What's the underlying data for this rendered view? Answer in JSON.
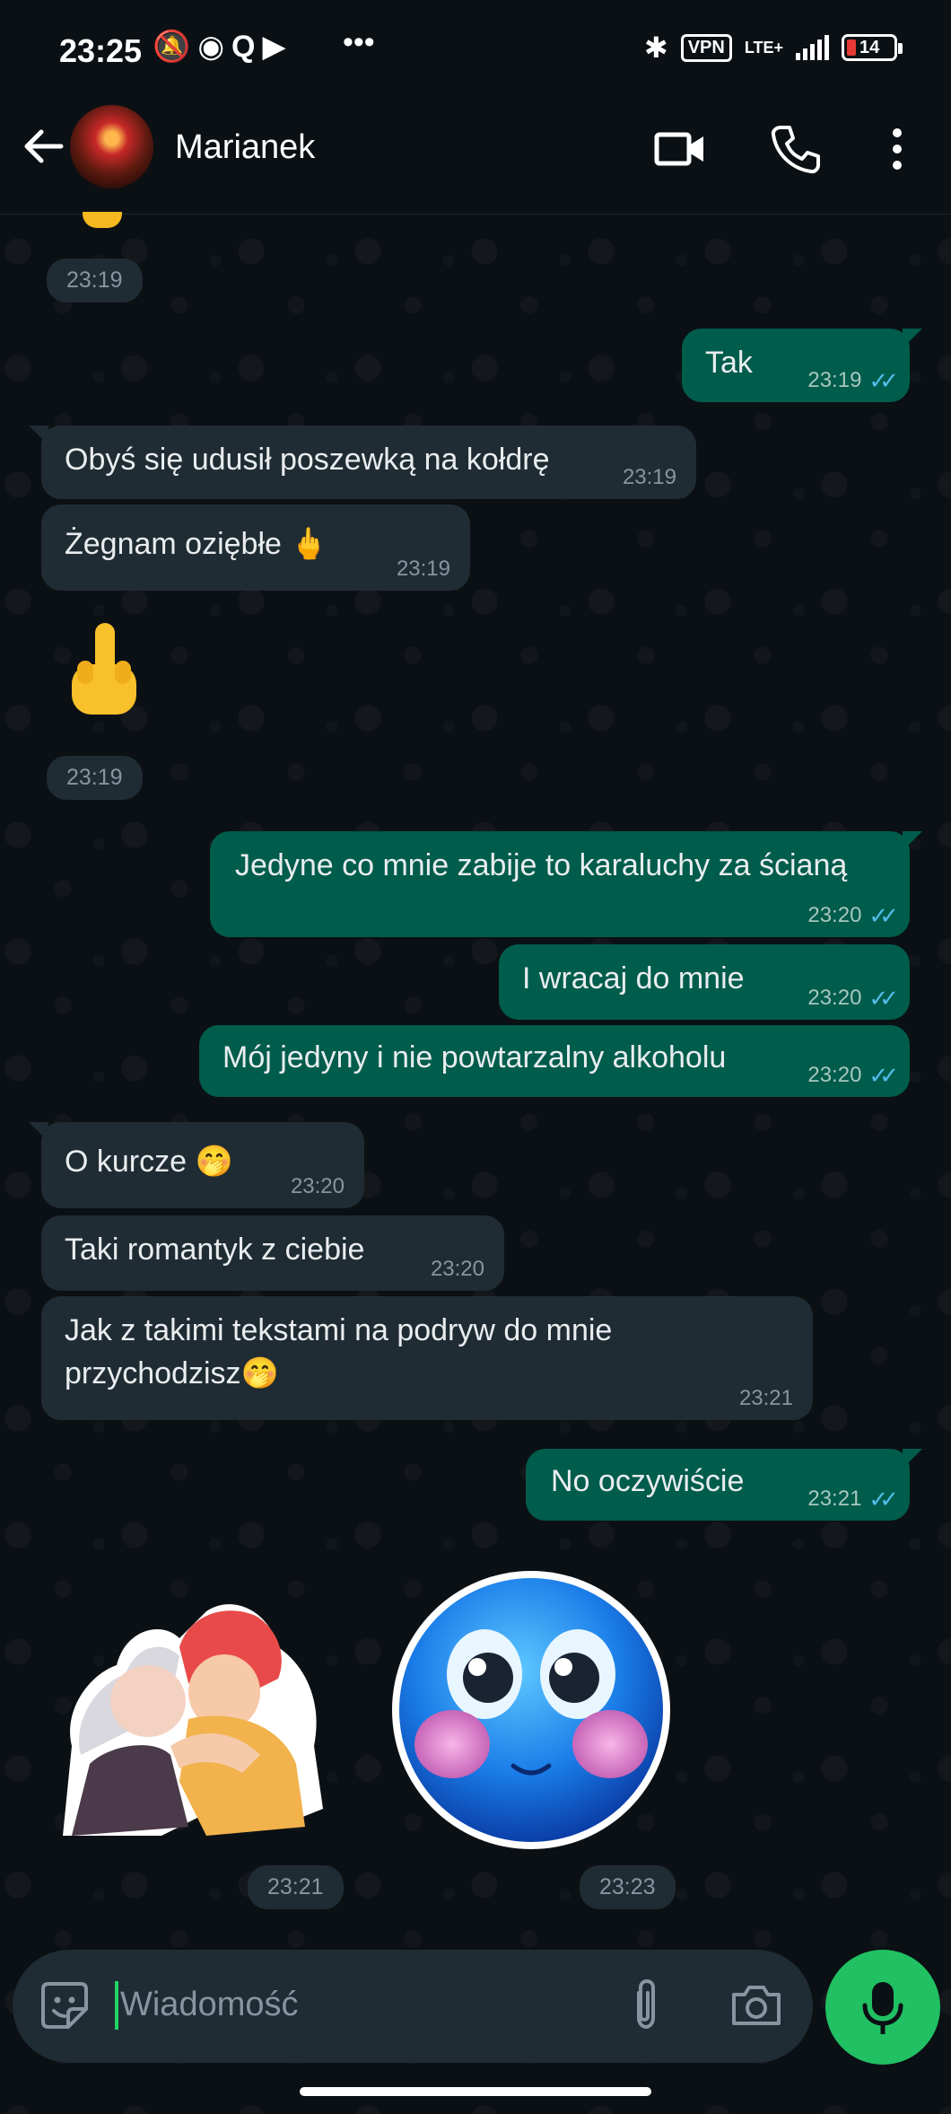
{
  "status_bar": {
    "time": "23:25",
    "vpn": "VPN",
    "network": "LTE+",
    "battery": "14"
  },
  "header": {
    "contact_name": "Marianek"
  },
  "messages": [
    {
      "dir": "in",
      "text": "",
      "time": "23:19"
    },
    {
      "dir": "out",
      "text": "Tak",
      "time": "23:19"
    },
    {
      "dir": "in",
      "text": "Obyś się udusił poszewką na kołdrę",
      "time": "23:19"
    },
    {
      "dir": "in",
      "text": "Żegnam oziębłe 🖕",
      "time": "23:19"
    },
    {
      "dir": "in",
      "text": "🖕",
      "time": "23:19"
    },
    {
      "dir": "out",
      "text": "Jedyne co mnie zabije to karaluchy za ścianą",
      "time": "23:20"
    },
    {
      "dir": "out",
      "text": "I wracaj do mnie",
      "time": "23:20"
    },
    {
      "dir": "out",
      "text": "Mój jedyny i nie powtarzalny alkoholu",
      "time": "23:20"
    },
    {
      "dir": "in",
      "text": "O kurcze 🤭",
      "time": "23:20"
    },
    {
      "dir": "in",
      "text": "Taki romantyk z ciebie",
      "time": "23:20"
    },
    {
      "dir": "in",
      "text": "Jak z takimi tekstami na podryw do mnie przychodzisz🤭",
      "time": "23:21"
    },
    {
      "dir": "out",
      "text": "No oczywiście",
      "time": "23:21"
    },
    {
      "dir": "in",
      "text": "",
      "time": "23:21"
    },
    {
      "dir": "in",
      "text": "",
      "time": "23:23"
    }
  ],
  "composer": {
    "placeholder": "Wiadomość"
  },
  "colors": {
    "outgoing_bubble": "#005c4b",
    "incoming_bubble": "#202c33",
    "read_ticks": "#53bdeb",
    "mic_button": "#21c063"
  }
}
